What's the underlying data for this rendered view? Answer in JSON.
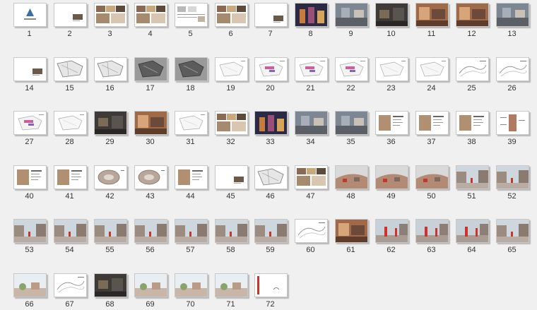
{
  "view": "slide-sorter",
  "colors": {
    "background": "#f0f0f0",
    "thumb_border": "#c8c8c8"
  },
  "slides": [
    {
      "num": "1",
      "style": "logo"
    },
    {
      "num": "2",
      "style": "blank-photo"
    },
    {
      "num": "3",
      "style": "collage"
    },
    {
      "num": "4",
      "style": "collage"
    },
    {
      "num": "5",
      "style": "collage-light"
    },
    {
      "num": "6",
      "style": "collage"
    },
    {
      "num": "7",
      "style": "blank-photo"
    },
    {
      "num": "8",
      "style": "photo-night"
    },
    {
      "num": "9",
      "style": "photo"
    },
    {
      "num": "10",
      "style": "photo-dark"
    },
    {
      "num": "11",
      "style": "photo-warm"
    },
    {
      "num": "12",
      "style": "photo-warm"
    },
    {
      "num": "13",
      "style": "photo"
    },
    {
      "num": "14",
      "style": "blank-photo"
    },
    {
      "num": "15",
      "style": "plan"
    },
    {
      "num": "16",
      "style": "plan"
    },
    {
      "num": "17",
      "style": "plan-dark"
    },
    {
      "num": "18",
      "style": "plan-dark"
    },
    {
      "num": "19",
      "style": "plan-light"
    },
    {
      "num": "20",
      "style": "plan-pink"
    },
    {
      "num": "21",
      "style": "plan-pink"
    },
    {
      "num": "22",
      "style": "plan-pink"
    },
    {
      "num": "23",
      "style": "plan-light"
    },
    {
      "num": "24",
      "style": "plan-light"
    },
    {
      "num": "25",
      "style": "sketch"
    },
    {
      "num": "26",
      "style": "sketch"
    },
    {
      "num": "27",
      "style": "plan-pink"
    },
    {
      "num": "28",
      "style": "plan-light"
    },
    {
      "num": "29",
      "style": "photo-dark"
    },
    {
      "num": "30",
      "style": "photo-warm"
    },
    {
      "num": "31",
      "style": "plan-light"
    },
    {
      "num": "32",
      "style": "collage"
    },
    {
      "num": "33",
      "style": "photo-night"
    },
    {
      "num": "34",
      "style": "photo"
    },
    {
      "num": "35",
      "style": "photo"
    },
    {
      "num": "36",
      "style": "diagram"
    },
    {
      "num": "37",
      "style": "diagram"
    },
    {
      "num": "38",
      "style": "diagram"
    },
    {
      "num": "39",
      "style": "diagram-center"
    },
    {
      "num": "40",
      "style": "diagram"
    },
    {
      "num": "41",
      "style": "diagram"
    },
    {
      "num": "42",
      "style": "render-round"
    },
    {
      "num": "43",
      "style": "render-round"
    },
    {
      "num": "44",
      "style": "diagram"
    },
    {
      "num": "45",
      "style": "blank-photo"
    },
    {
      "num": "46",
      "style": "plan"
    },
    {
      "num": "47",
      "style": "collage"
    },
    {
      "num": "48",
      "style": "render-aerial"
    },
    {
      "num": "49",
      "style": "render-aerial"
    },
    {
      "num": "50",
      "style": "render-aerial"
    },
    {
      "num": "51",
      "style": "render-street"
    },
    {
      "num": "52",
      "style": "render-street"
    },
    {
      "num": "53",
      "style": "render-street"
    },
    {
      "num": "54",
      "style": "render-street"
    },
    {
      "num": "55",
      "style": "render-street"
    },
    {
      "num": "56",
      "style": "render-street"
    },
    {
      "num": "57",
      "style": "render-street"
    },
    {
      "num": "58",
      "style": "render-street"
    },
    {
      "num": "59",
      "style": "render-street"
    },
    {
      "num": "60",
      "style": "sketch"
    },
    {
      "num": "61",
      "style": "photo-warm"
    },
    {
      "num": "62",
      "style": "render-red"
    },
    {
      "num": "63",
      "style": "render-red"
    },
    {
      "num": "64",
      "style": "render-red"
    },
    {
      "num": "65",
      "style": "render-street"
    },
    {
      "num": "66",
      "style": "render-sky"
    },
    {
      "num": "67",
      "style": "sketch"
    },
    {
      "num": "68",
      "style": "photo-dark"
    },
    {
      "num": "69",
      "style": "render-sky"
    },
    {
      "num": "70",
      "style": "render-sky"
    },
    {
      "num": "71",
      "style": "render-sky"
    },
    {
      "num": "72",
      "style": "red-bar"
    }
  ]
}
